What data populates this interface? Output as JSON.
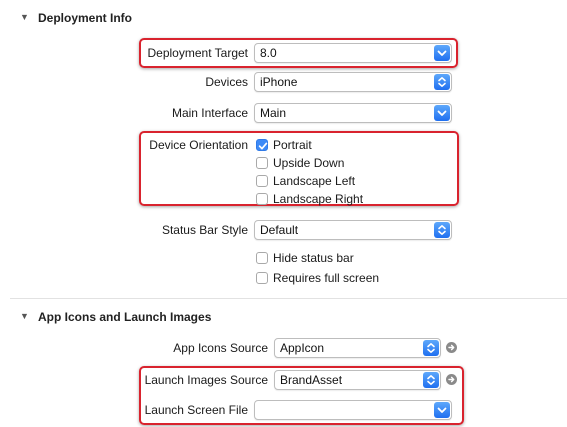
{
  "deployment": {
    "title": "Deployment Info",
    "deployment_target": {
      "label": "Deployment Target",
      "value": "8.0"
    },
    "devices": {
      "label": "Devices",
      "value": "iPhone"
    },
    "main_interface": {
      "label": "Main Interface",
      "value": "Main"
    },
    "orientation": {
      "label": "Device Orientation",
      "options": [
        {
          "label": "Portrait",
          "checked": true
        },
        {
          "label": "Upside Down",
          "checked": false
        },
        {
          "label": "Landscape Left",
          "checked": false
        },
        {
          "label": "Landscape Right",
          "checked": false
        }
      ]
    },
    "status_bar_style": {
      "label": "Status Bar Style",
      "value": "Default"
    },
    "hide_status_bar": {
      "label": "Hide status bar",
      "checked": false
    },
    "requires_full_screen": {
      "label": "Requires full screen",
      "checked": false
    }
  },
  "app_icons": {
    "title": "App Icons and Launch Images",
    "icons_source": {
      "label": "App Icons Source",
      "value": "AppIcon"
    },
    "launch_images_source": {
      "label": "Launch Images Source",
      "value": "BrandAsset"
    },
    "launch_screen_file": {
      "label": "Launch Screen File",
      "value": ""
    }
  },
  "icons": {
    "disclosure": "disclosure-triangle-down-icon",
    "dropdown": "chevron-down-icon",
    "stepper": "up-down-arrows-icon",
    "checkmark": "checkmark-icon",
    "goto": "arrow-circle-right-icon"
  },
  "colors": {
    "highlight": "#d9232e",
    "accent": "#3d8af7"
  }
}
